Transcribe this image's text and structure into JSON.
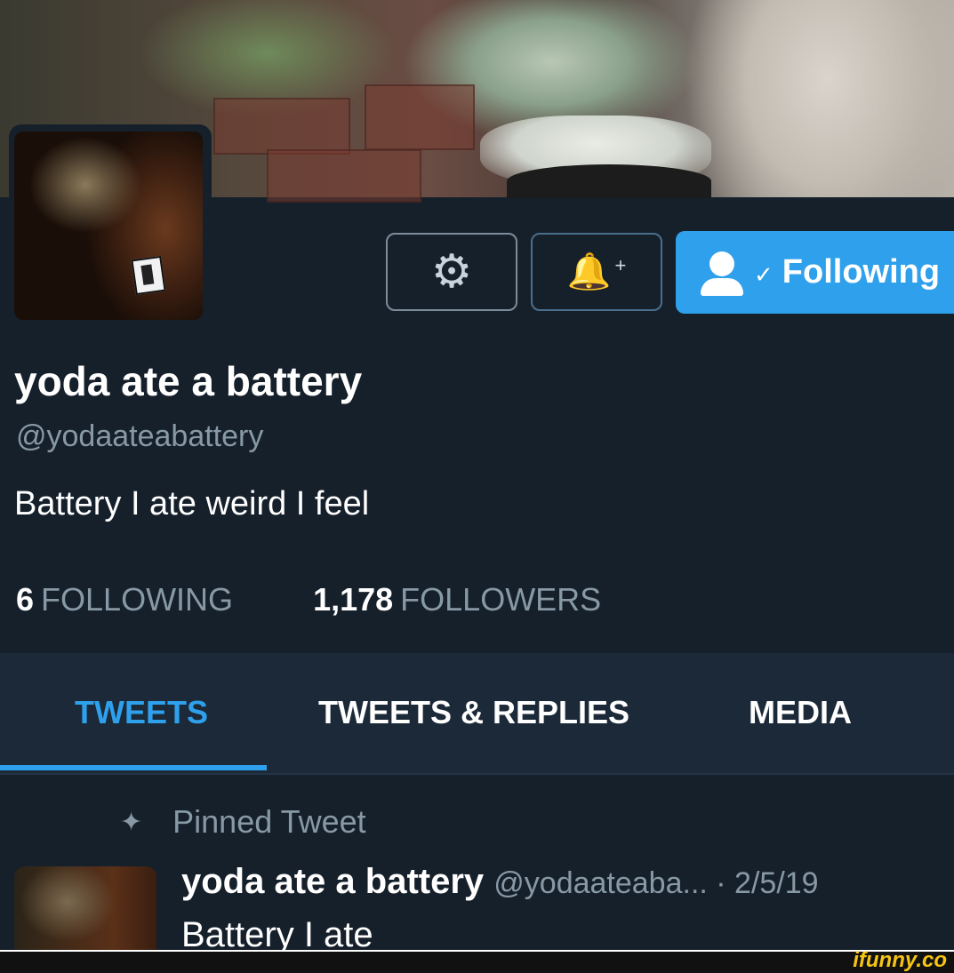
{
  "profile": {
    "name": "yoda ate a battery",
    "handle": "@yodaateabattery",
    "bio": "Battery I ate weird I feel",
    "following_count": "6",
    "following_label": "FOLLOWING",
    "followers_count": "1,178",
    "followers_label": "FOLLOWERS"
  },
  "actions": {
    "settings_icon": "gear-icon",
    "notify_icon": "bell-plus-icon",
    "follow_label": "Following"
  },
  "tabs": [
    {
      "label": "TWEETS",
      "active": true
    },
    {
      "label": "TWEETS & REPLIES",
      "active": false
    },
    {
      "label": "MEDIA",
      "active": false
    }
  ],
  "pinned": {
    "label": "Pinned Tweet",
    "tweet_name": "yoda ate a battery",
    "tweet_meta": "@yodaateaba... · 2/5/19",
    "tweet_text": "Battery I ate"
  },
  "watermark": "ifunny.co",
  "colors": {
    "accent": "#2ea0ec",
    "background": "#16202b",
    "muted_text": "#8899a6"
  }
}
